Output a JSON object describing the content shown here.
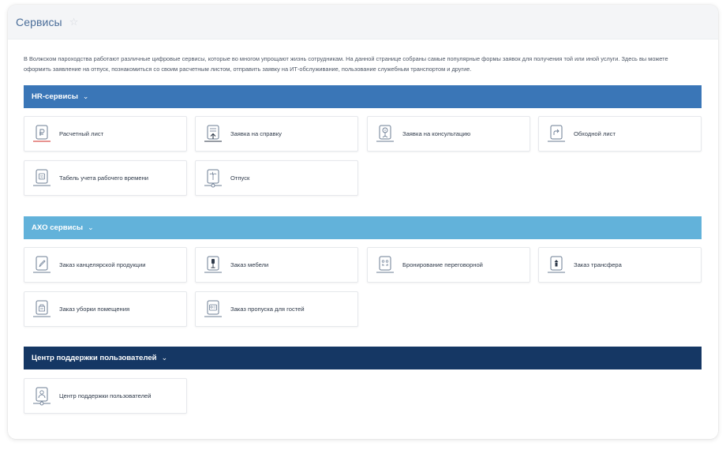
{
  "header": {
    "title": "Сервисы"
  },
  "intro": "В Волжском пароходства работают различные цифровые сервисы, которые во многом упрощают жизнь сотрудникам. На данной странице собраны самые популярные формы заявок для получения той или иной услуги. Здесь вы можете оформить заявление на отпуск, познакомиться со своим расчетным листом, отправить заявку на ИТ-обслуживание, пользование служебным транспортом и другие.",
  "sections": [
    {
      "title": "HR-сервисы",
      "color": "#3a76b7",
      "items": [
        {
          "label": "Расчетный лист",
          "icon": "ruble-icon"
        },
        {
          "label": "Заявка на справку",
          "icon": "document-upload-icon"
        },
        {
          "label": "Заявка на консультацию",
          "icon": "consultation-icon"
        },
        {
          "label": "Обходной лист",
          "icon": "share-arrow-icon"
        },
        {
          "label": "Табель учета рабочего времени",
          "icon": "calendar-icon"
        },
        {
          "label": "Отпуск",
          "icon": "palm-tree-icon"
        }
      ]
    },
    {
      "title": "АХО сервисы",
      "color": "#62b2da",
      "items": [
        {
          "label": "Заказ канцелярской продукции",
          "icon": "pen-icon"
        },
        {
          "label": "Заказ мебели",
          "icon": "lamp-icon"
        },
        {
          "label": "Бронирование переговорной",
          "icon": "meeting-room-icon"
        },
        {
          "label": "Заказ трансфера",
          "icon": "transfer-icon"
        },
        {
          "label": "Заказ уборки помещения",
          "icon": "cleaning-icon"
        },
        {
          "label": "Заказ пропуска для гостей",
          "icon": "guest-pass-icon"
        }
      ]
    },
    {
      "title": "Центр поддержки пользователей",
      "color": "#153764",
      "items": [
        {
          "label": "Центр поддержки пользователей",
          "icon": "user-support-icon"
        }
      ]
    }
  ]
}
